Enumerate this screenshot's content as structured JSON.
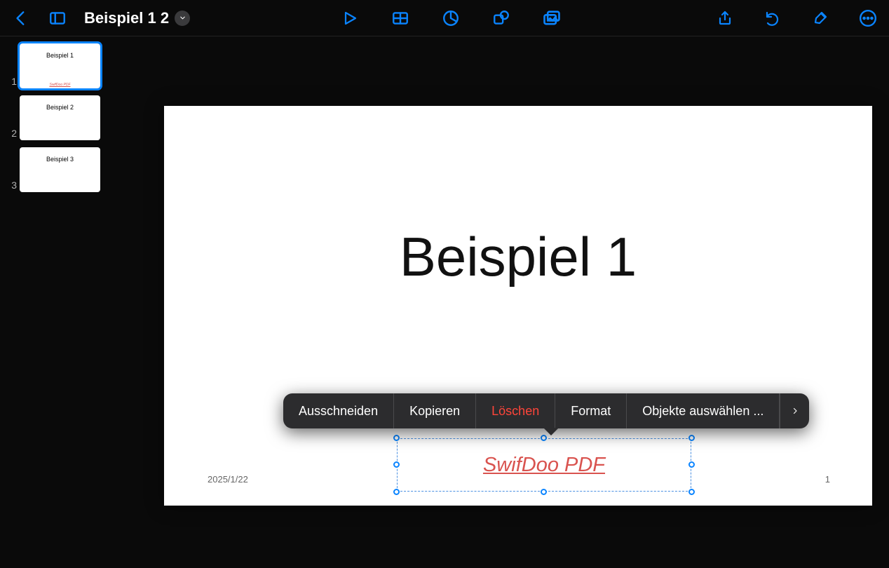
{
  "document": {
    "title": "Beispiel 1 2"
  },
  "thumbnails": [
    {
      "num": "1",
      "title": "Beispiel 1",
      "foot": "SwifDoo PDF",
      "selected": true
    },
    {
      "num": "2",
      "title": "Beispiel 2",
      "foot": "",
      "selected": false
    },
    {
      "num": "3",
      "title": "Beispiel 3",
      "foot": "",
      "selected": false
    }
  ],
  "slide": {
    "title": "Beispiel 1",
    "date": "2025/1/22",
    "page_number": "1",
    "hyperlink_text": "SwifDoo PDF"
  },
  "context_menu": {
    "items": [
      {
        "label": "Ausschneiden",
        "danger": false
      },
      {
        "label": "Kopieren",
        "danger": false
      },
      {
        "label": "Löschen",
        "danger": true
      },
      {
        "label": "Format",
        "danger": false
      },
      {
        "label": "Objekte auswählen ...",
        "danger": false
      }
    ]
  },
  "colors": {
    "accent": "#0a84ff",
    "danger": "#ff453a",
    "hyperlink": "#d9534f"
  }
}
